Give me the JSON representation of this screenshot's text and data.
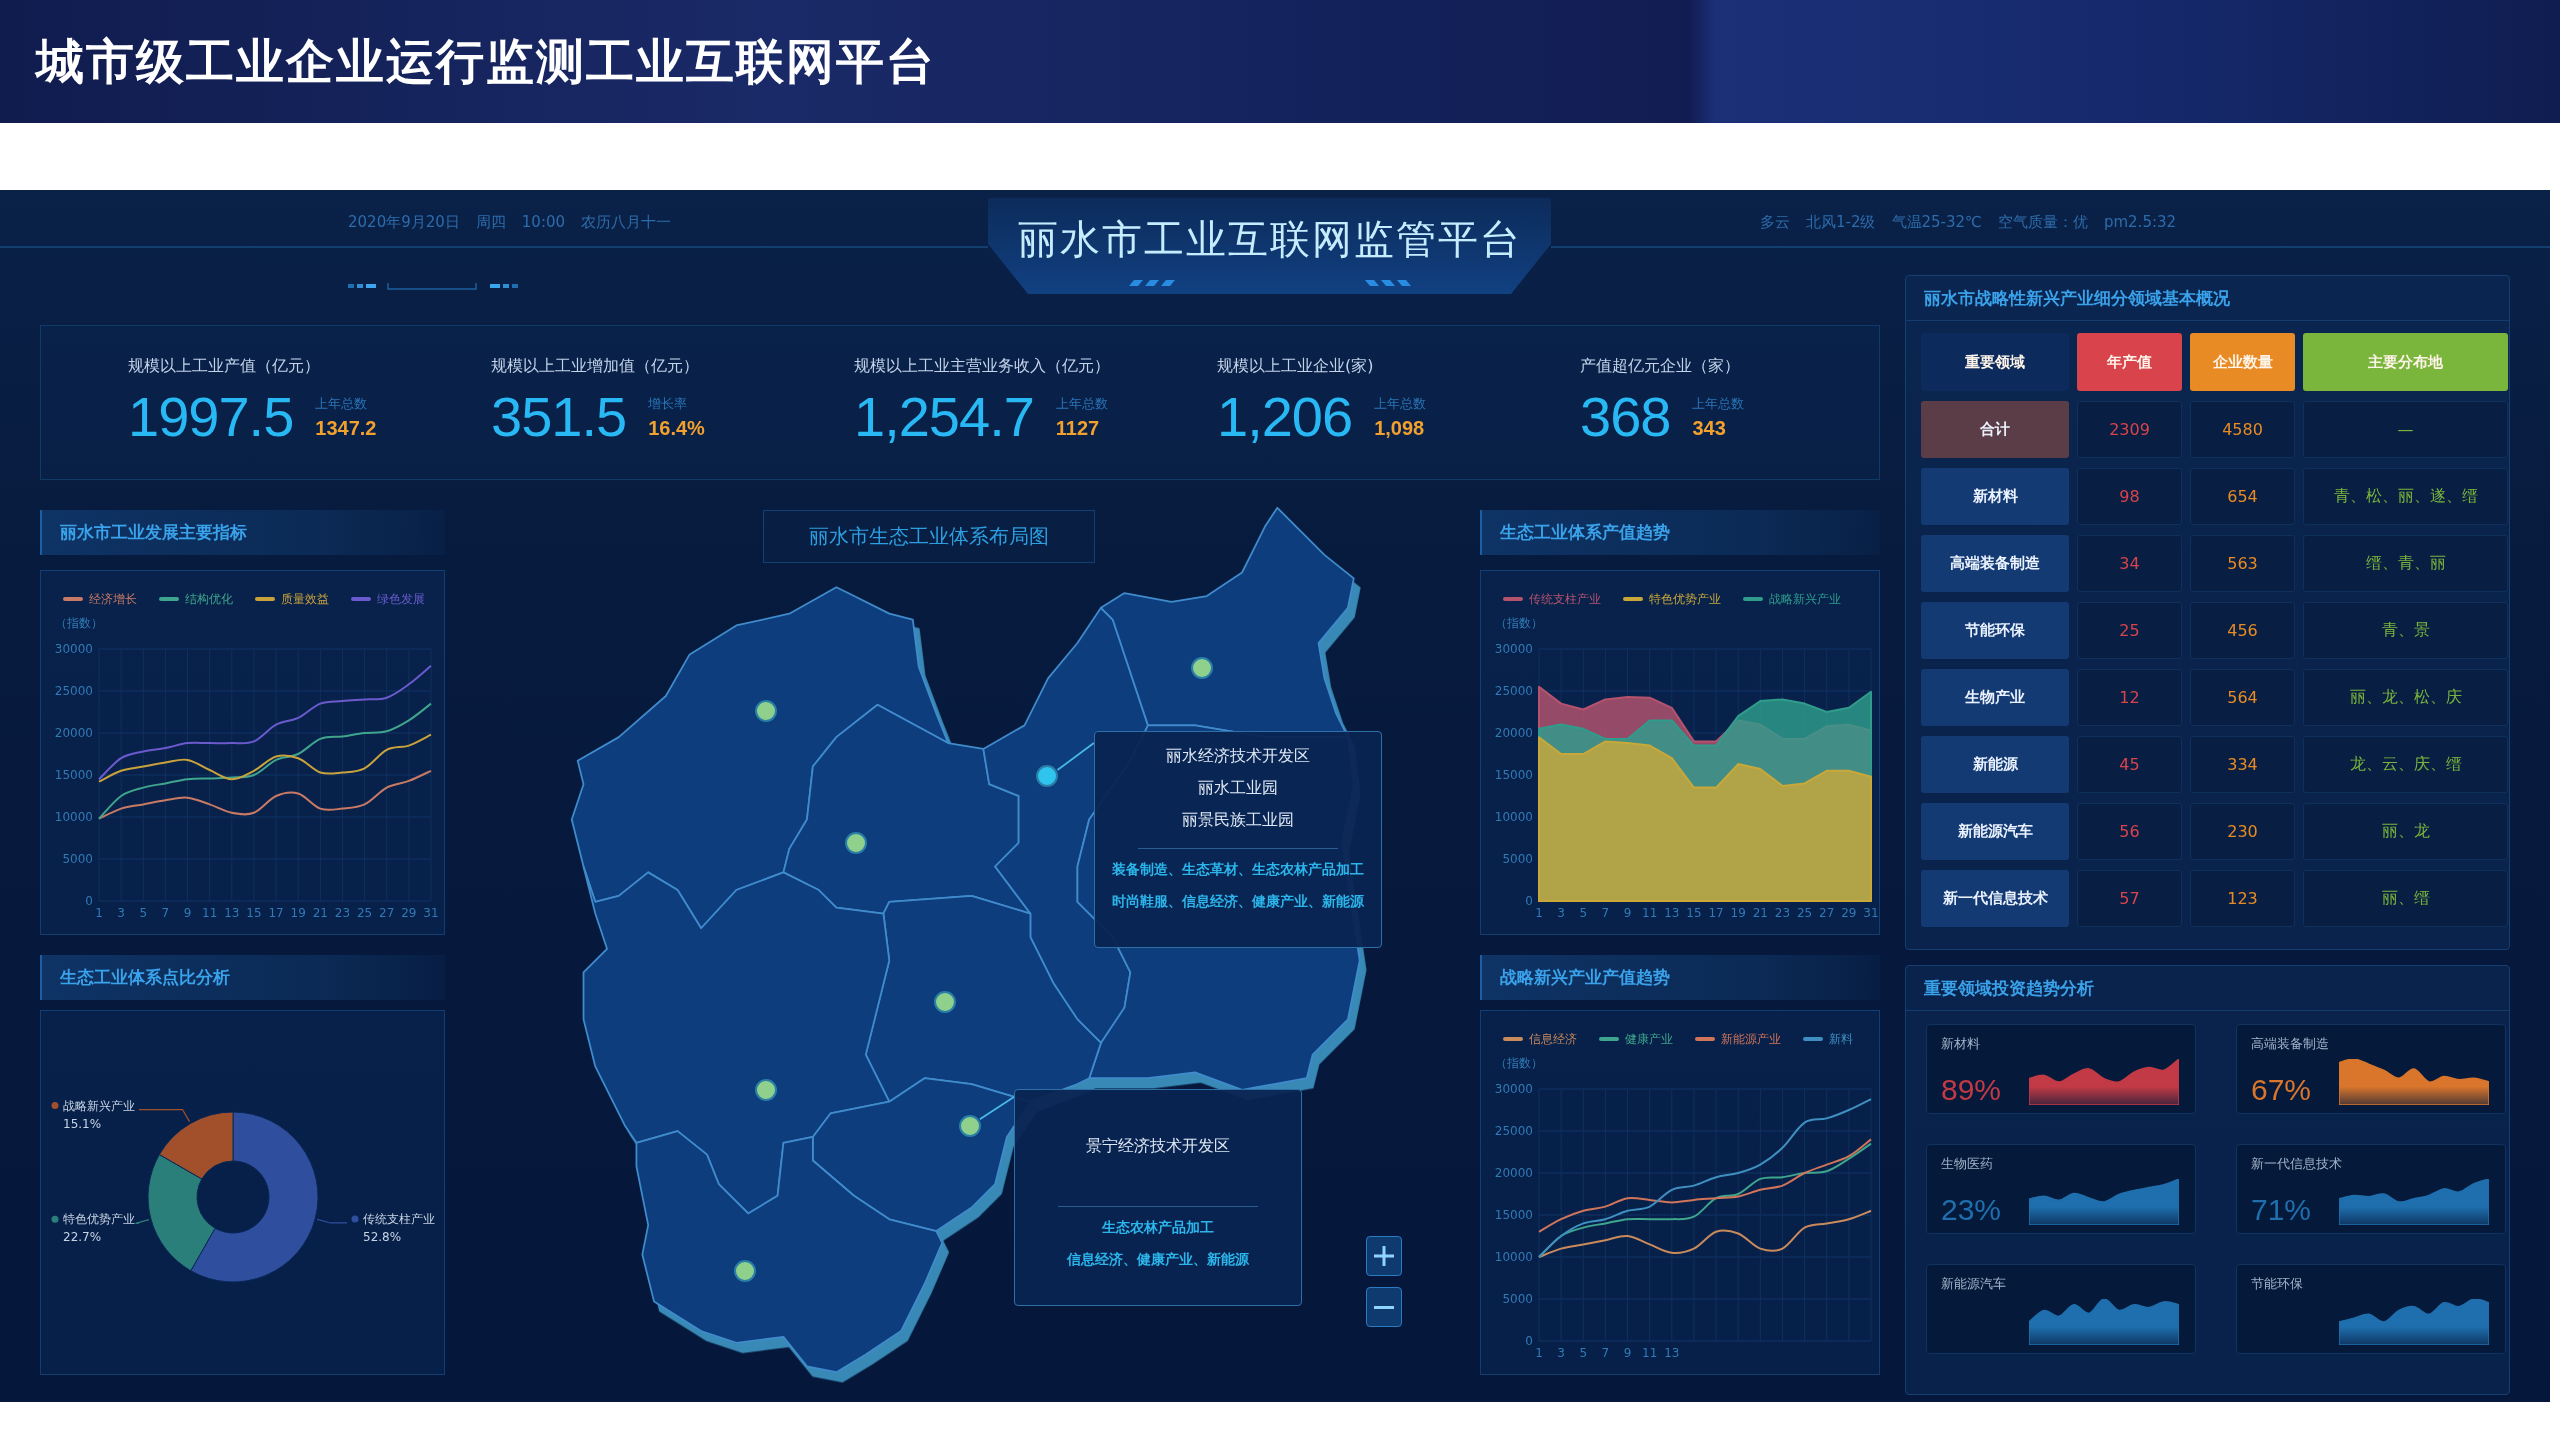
{
  "banner": {
    "title": "城市级工业企业运行监测工业互联网平台"
  },
  "header": {
    "date_items": [
      "2020年9月20日",
      "周四",
      "10:00",
      "农历八月十一"
    ],
    "title": "丽水市工业互联网监管平台",
    "weather_items": [
      "多云",
      "北风1-2级",
      "气温25-32℃",
      "空气质量：优",
      "pm2.5:32"
    ]
  },
  "kpis": [
    {
      "label": "规模以上工业产值（亿元）",
      "value": "1997.5",
      "sub_label": "上年总数",
      "sub_value": "1347.2"
    },
    {
      "label": "规模以上工业增加值（亿元）",
      "value": "351.5",
      "sub_label": "增长率",
      "sub_value": "16.4%"
    },
    {
      "label": "规模以上工业主营业务收入（亿元）",
      "value": "1,254.7",
      "sub_label": "上年总数",
      "sub_value": "1127"
    },
    {
      "label": "规模以上工业企业(家)",
      "value": "1,206",
      "sub_label": "上年总数",
      "sub_value": "1,098"
    },
    {
      "label": "产值超亿元企业（家）",
      "value": "368",
      "sub_label": "上年总数",
      "sub_value": "343"
    }
  ],
  "left_panels": [
    {
      "title": "丽水市工业发展主要指标",
      "chart_data": {
        "type": "line",
        "ylabel": "（指数）",
        "legend": "top",
        "grid": true,
        "x": [
          1,
          3,
          5,
          7,
          9,
          11,
          13,
          15,
          17,
          19,
          21,
          23,
          25,
          27,
          29,
          31
        ],
        "xlim": [
          1,
          31
        ],
        "ylim": [
          0,
          30000
        ],
        "yticks": [
          0,
          5000,
          10000,
          15000,
          20000,
          25000,
          30000
        ],
        "xticks": [
          {
            "value": 1,
            "label": "1"
          },
          {
            "value": 3,
            "label": "3"
          },
          {
            "value": 5,
            "label": "5"
          },
          {
            "value": 7,
            "label": "7"
          },
          {
            "value": 9,
            "label": "9"
          },
          {
            "value": 11,
            "label": "11"
          },
          {
            "value": 13,
            "label": "13"
          },
          {
            "value": 15,
            "label": "15"
          },
          {
            "value": 17,
            "label": "17"
          },
          {
            "value": 19,
            "label": "19"
          },
          {
            "value": 21,
            "label": "21"
          },
          {
            "value": 23,
            "label": "23"
          },
          {
            "value": 25,
            "label": "25"
          },
          {
            "value": 27,
            "label": "27"
          },
          {
            "value": 29,
            "label": "29"
          },
          {
            "value": 31,
            "label": "31"
          }
        ],
        "series": [
          {
            "name": "经济增长",
            "color": "#c97a64",
            "values": [
              9800,
              11000,
              11500,
              12000,
              12300,
              11500,
              10500,
              10500,
              12500,
              12800,
              11000,
              11000,
              11500,
              13500,
              14300,
              15500
            ]
          },
          {
            "name": "结构优化",
            "color": "#3fa58c",
            "values": [
              9800,
              12500,
              13500,
              14000,
              14500,
              14600,
              14700,
              15000,
              16800,
              17500,
              19300,
              19600,
              20000,
              20200,
              21500,
              23500
            ]
          },
          {
            "name": "质量效益",
            "color": "#c9a23c",
            "values": [
              14200,
              15500,
              16000,
              16500,
              16800,
              15600,
              14500,
              15500,
              17200,
              17000,
              15300,
              15300,
              15800,
              18000,
              18500,
              19800
            ]
          },
          {
            "name": "绿色发展",
            "color": "#6a5acd",
            "values": [
              14500,
              17000,
              17800,
              18200,
              18800,
              18800,
              18800,
              19000,
              21000,
              21800,
              23500,
              23800,
              24000,
              24200,
              25800,
              28000
            ]
          }
        ]
      }
    },
    {
      "title": "生态工业体系点比分析",
      "chart_data": {
        "type": "donut",
        "legend": "top right",
        "categories": [
          "传统支柱产业",
          "特色优势产业",
          "战略新兴产业"
        ],
        "values": [
          52.8,
          22.7,
          15.1
        ],
        "value_labels": [
          "52.8%",
          "22.7%",
          "15.1%"
        ]
      }
    }
  ],
  "map": {
    "title": "丽水市生态工业体系布局图",
    "markers": [
      {
        "color": "#8fd08c"
      },
      {
        "color": "#8fd08c"
      },
      {
        "color": "#2fc4ee"
      },
      {
        "color": "#8fd08c"
      },
      {
        "color": "#8fd08c"
      },
      {
        "color": "#8fd08c"
      },
      {
        "color": "#8fd08c"
      },
      {
        "color": "#8fd08c"
      }
    ],
    "callouts": [
      {
        "names": [
          "丽水经济技术开发区",
          "丽水工业园",
          "丽景民族工业园"
        ],
        "industries": [
          "装备制造、生态革材、生态农林产品加工",
          "时尚鞋服、信息经济、健康产业、新能源"
        ]
      },
      {
        "names": [
          "景宁经济技术开发区"
        ],
        "industries": [
          "生态农林产品加工",
          "信息经济、健康产业、新能源"
        ]
      }
    ]
  },
  "middle_panels": [
    {
      "title": "生态工业体系产值趋势",
      "chart_data": {
        "type": "area",
        "stacked": false,
        "ylabel": "（指数）",
        "legend": "top",
        "grid": true,
        "x": [
          1,
          3,
          5,
          7,
          9,
          11,
          13,
          15,
          17,
          19,
          21,
          23,
          25,
          27,
          29,
          31
        ],
        "xlim": [
          1,
          31
        ],
        "ylim": [
          0,
          30000
        ],
        "yticks": [
          0,
          5000,
          10000,
          15000,
          20000,
          25000,
          30000
        ],
        "xticks": [
          {
            "value": 1,
            "label": "1"
          },
          {
            "value": 3,
            "label": "3"
          },
          {
            "value": 5,
            "label": "5"
          },
          {
            "value": 7,
            "label": "7"
          },
          {
            "value": 9,
            "label": "9"
          },
          {
            "value": 11,
            "label": "11"
          },
          {
            "value": 13,
            "label": "13"
          },
          {
            "value": 15,
            "label": "15"
          },
          {
            "value": 17,
            "label": "17"
          },
          {
            "value": 19,
            "label": "19"
          },
          {
            "value": 21,
            "label": "21"
          },
          {
            "value": 23,
            "label": "23"
          },
          {
            "value": 25,
            "label": "25"
          },
          {
            "value": 27,
            "label": "27"
          },
          {
            "value": 29,
            "label": "29"
          },
          {
            "value": 31,
            "label": "31"
          }
        ],
        "series": [
          {
            "name": "传统支柱产业",
            "color": "#b5536e",
            "values": [
              25500,
              23500,
              22800,
              24000,
              24300,
              24200,
              23000,
              19000,
              19000,
              21500,
              21000,
              19300,
              19300,
              20800,
              21000,
              20300
            ]
          },
          {
            "name": "特色优势产业",
            "color": "#c9a83a",
            "values": [
              19500,
              17500,
              17500,
              19000,
              18800,
              18500,
              17000,
              13500,
              13500,
              16300,
              15700,
              13700,
              14000,
              15500,
              15500,
              14800
            ]
          },
          {
            "name": "战略新兴产业",
            "color": "#2f9c8c",
            "values": [
              20500,
              21000,
              20500,
              19300,
              19300,
              21500,
              21500,
              18500,
              18500,
              22000,
              23800,
              24000,
              23500,
              22500,
              23000,
              24900
            ]
          }
        ]
      }
    },
    {
      "title": "战略新兴产业产值趋势",
      "chart_data": {
        "type": "line",
        "ylabel": "（指数）",
        "legend": "top",
        "grid": true,
        "x": [
          1,
          3,
          5,
          7,
          9,
          11,
          13,
          15,
          17,
          19,
          21,
          23,
          25,
          27,
          29,
          31
        ],
        "xlim": [
          1,
          31
        ],
        "ylim": [
          0,
          30000
        ],
        "yticks": [
          0,
          5000,
          10000,
          15000,
          20000,
          25000,
          30000
        ],
        "xticks": [
          {
            "value": 1,
            "label": "1"
          },
          {
            "value": 3,
            "label": "3"
          },
          {
            "value": 5,
            "label": "5"
          },
          {
            "value": 7,
            "label": "7"
          },
          {
            "value": 9,
            "label": "9"
          },
          {
            "value": 11,
            "label": "11"
          },
          {
            "value": 13,
            "label": "13"
          }
        ],
        "series": [
          {
            "name": "信息经济",
            "color": "#c98a5c",
            "values": [
              10000,
              11000,
              11500,
              12000,
              12500,
              11500,
              10500,
              11000,
              13000,
              12800,
              11000,
              11000,
              13500,
              14000,
              14500,
              15500
            ]
          },
          {
            "name": "健康产业",
            "color": "#3fa58c",
            "values": [
              10000,
              12500,
              13500,
              14000,
              14500,
              14500,
              14500,
              14800,
              17000,
              17500,
              19300,
              19500,
              20000,
              20200,
              21700,
              23500
            ]
          },
          {
            "name": "新能源产业",
            "color": "#d0745a",
            "values": [
              13000,
              14500,
              15500,
              16000,
              17000,
              16800,
              16500,
              16800,
              17000,
              17200,
              18000,
              18500,
              20000,
              21000,
              22000,
              24000
            ]
          },
          {
            "name": "新料",
            "color": "#3f8fc0",
            "values": [
              10000,
              12500,
              14000,
              14500,
              15500,
              16000,
              18000,
              18500,
              19500,
              20000,
              21000,
              23000,
              26000,
              26500,
              27500,
              28800
            ]
          }
        ]
      }
    }
  ],
  "table": {
    "title": "丽水市战略性新兴产业细分领域基本概况",
    "columns": [
      {
        "label": "重要领域",
        "color": "#0c2b5c"
      },
      {
        "label": "年产值",
        "color": "#d9434b"
      },
      {
        "label": "企业数量",
        "color": "#e88b24"
      },
      {
        "label": "主要分布地",
        "color": "#7ab53c"
      }
    ],
    "rows": [
      {
        "kind": "total",
        "cells": [
          "合计",
          "2309",
          "4580",
          "—"
        ]
      },
      {
        "kind": "item",
        "cells": [
          "新材料",
          "98",
          "654",
          "青、松、丽、遂、缙"
        ]
      },
      {
        "kind": "item",
        "cells": [
          "高端装备制造",
          "34",
          "563",
          "缙、青、丽"
        ]
      },
      {
        "kind": "item",
        "cells": [
          "节能环保",
          "25",
          "456",
          "青、景"
        ]
      },
      {
        "kind": "item",
        "cells": [
          "生物产业",
          "12",
          "564",
          "丽、龙、松、庆"
        ]
      },
      {
        "kind": "item",
        "cells": [
          "新能源",
          "45",
          "334",
          "龙、云、庆、缙"
        ]
      },
      {
        "kind": "item",
        "cells": [
          "新能源汽车",
          "56",
          "230",
          "丽、龙"
        ]
      },
      {
        "kind": "item",
        "cells": [
          "新一代信息技术",
          "57",
          "123",
          "丽、缙"
        ]
      }
    ]
  },
  "investment": {
    "title": "重要领域投资趋势分析",
    "cards": [
      {
        "label": "新材料",
        "percent": "89%",
        "color": "#c23a45"
      },
      {
        "label": "高端装备制造",
        "percent": "67%",
        "color": "#d9762c"
      },
      {
        "label": "生物医药",
        "percent": "23%",
        "color": "#1f6fae"
      },
      {
        "label": "新一代信息技术",
        "percent": "71%",
        "color": "#1f6fae"
      },
      {
        "label": "新能源汽车",
        "color": "#1f6fae"
      },
      {
        "label": "节能环保",
        "color": "#1f6fae"
      }
    ]
  }
}
